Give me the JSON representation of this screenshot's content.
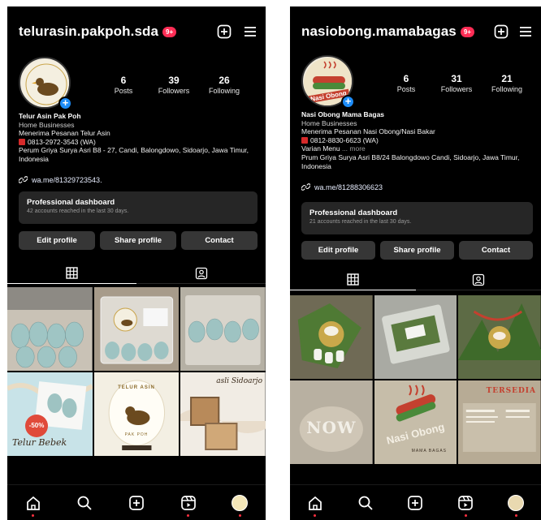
{
  "left": {
    "username": "telurasin.pakpoh.sda",
    "notif_badge": "9+",
    "stats": [
      {
        "value": "6",
        "label": "Posts"
      },
      {
        "value": "39",
        "label": "Followers"
      },
      {
        "value": "26",
        "label": "Following"
      }
    ],
    "avatar_text": "TELUR ASIN PAK POH",
    "bio": {
      "name": "Telur Asin Pak Poh",
      "category": "Home Businesses",
      "line1": "Menerima Pesanan Telur Asin",
      "phone": "0813-2972-3543 (WA)",
      "address": "Perum Griya Surya Asri B8 - 27, Candi, Balongdowo, Sidoarjo, Jawa Timur, Indonesia"
    },
    "link": "wa.me/81329723543.",
    "dashboard": {
      "title": "Professional dashboard",
      "subtitle": "42 accounts reached in the last 30 days."
    },
    "buttons": {
      "edit": "Edit profile",
      "share": "Share profile",
      "contact": "Contact"
    },
    "posts_text": {
      "discount": "-50%",
      "caption_script": "Telur Bebek",
      "brand_text": "TELUR ASIN",
      "brand_sub": "PAK POH",
      "origin_script": "asli Sidoarjo"
    }
  },
  "right": {
    "username": "nasiobong.mamabagas",
    "notif_badge": "9+",
    "stats": [
      {
        "value": "6",
        "label": "Posts"
      },
      {
        "value": "31",
        "label": "Followers"
      },
      {
        "value": "21",
        "label": "Following"
      }
    ],
    "avatar_text": "Nasi Obong",
    "bio": {
      "name": "Nasi Obong Mama Bagas",
      "category": "Home Businesses",
      "line1": "Menerima Pesanan Nasi Obong/Nasi Bakar",
      "phone": "0812-8830-6623 (WA)",
      "menu": "Varian Menu",
      "more": "... more",
      "address": "Prum Griya Surya Asri B8/24 Balongdowo Candi, Sidoarjo, Jawa Timur, Indonesia"
    },
    "link": "wa.me/81288306623",
    "dashboard": {
      "title": "Professional dashboard",
      "subtitle": "21 accounts reached in the last 30 days."
    },
    "buttons": {
      "edit": "Edit profile",
      "share": "Share profile",
      "contact": "Contact"
    },
    "posts_text": {
      "now_text": "NOW",
      "brand_text": "Nasi Obong",
      "brand_sub": "MAMA BAGAS",
      "menu_title": "TERSEDIA"
    }
  },
  "colors": {
    "background": "#000000",
    "button": "#363636",
    "dashboard": "#262626",
    "badge": "#ff2d55",
    "accent_blue": "#1d8cf8",
    "nav_dot": "#ff3040"
  }
}
